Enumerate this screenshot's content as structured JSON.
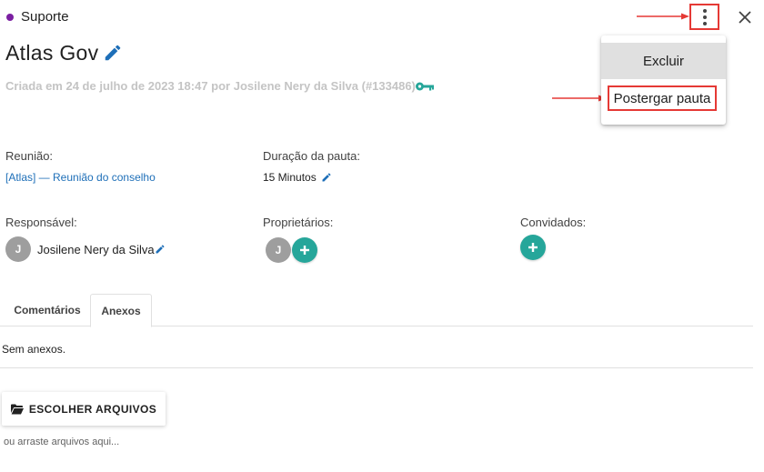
{
  "header": {
    "category": "Suporte",
    "category_color": "#7b1fa2"
  },
  "agenda": {
    "title": "Atlas Gov",
    "created_text": "Criada em 24 de julho de 2023 18:47 por Josilene Nery da Silva (#133486)"
  },
  "menu": {
    "items": [
      {
        "label": "Excluir"
      },
      {
        "label": "Postergar pauta"
      }
    ]
  },
  "fields": {
    "meeting": {
      "label": "Reunião:",
      "value": "[Atlas] — Reunião do conselho"
    },
    "duration": {
      "label": "Duração da pauta:",
      "value": "15 Minutos"
    },
    "responsible": {
      "label": "Responsável:",
      "initial": "J",
      "name": "Josilene Nery da Silva"
    },
    "owners": {
      "label": "Proprietários:",
      "initials": [
        "J"
      ]
    },
    "guests": {
      "label": "Convidados:"
    }
  },
  "tabs": [
    {
      "label": "Comentários",
      "active": false
    },
    {
      "label": "Anexos",
      "active": true
    }
  ],
  "attachments": {
    "empty_text": "Sem anexos.",
    "upload_label": "ESCOLHER ARQUIVOS",
    "drop_hint": "ou arraste arquivos aqui..."
  },
  "colors": {
    "accent": "#26a69a",
    "link": "#1e6fb8",
    "annotation": "#e53935"
  },
  "icons": {
    "more": "kebab-menu-icon",
    "close": "close-icon",
    "edit": "pencil-icon",
    "key": "key-icon",
    "add": "plus-icon",
    "folder": "folder-open-icon"
  }
}
